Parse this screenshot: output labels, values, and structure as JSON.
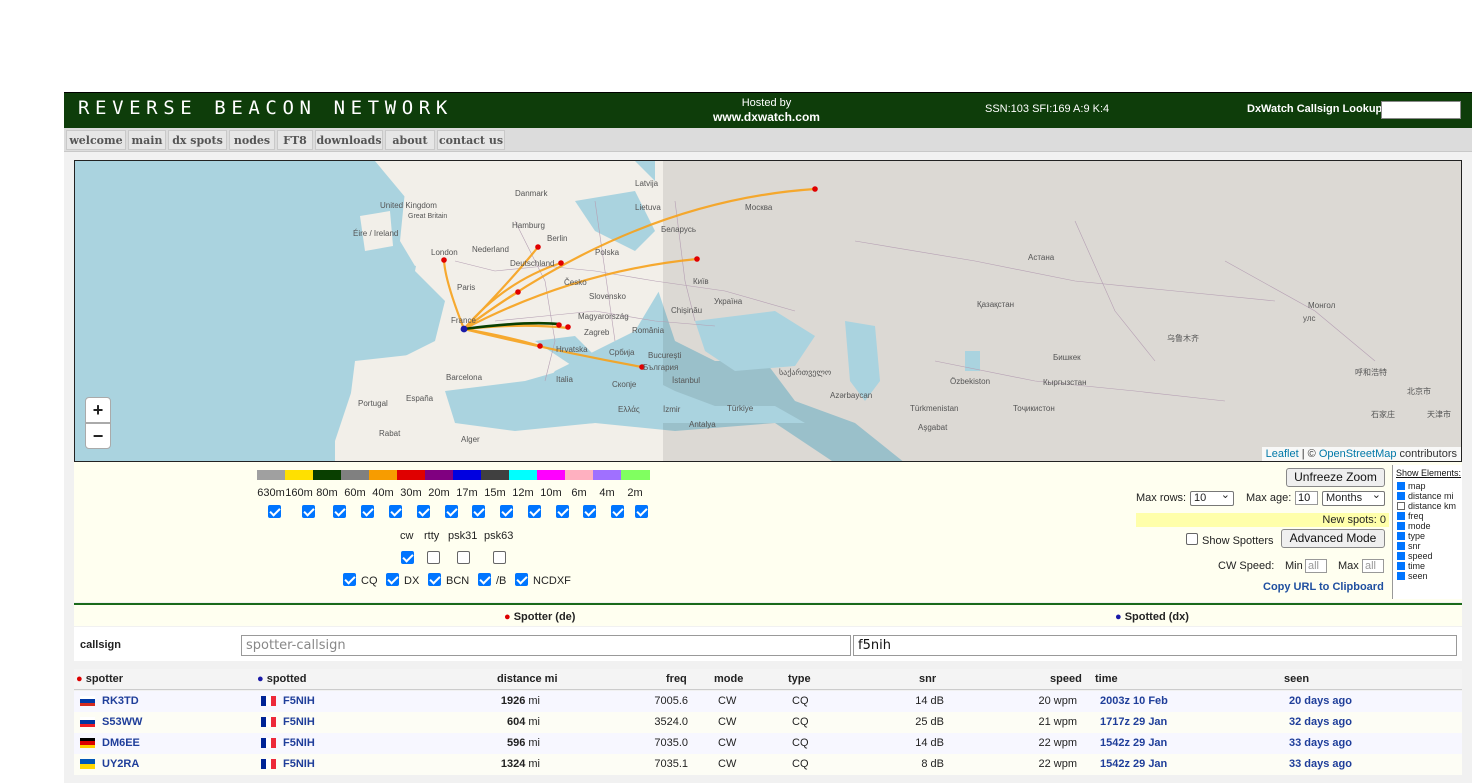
{
  "header": {
    "logo": "REVERSE BEACON NETWORK",
    "hosted_line1": "Hosted by",
    "hosted_line2": "www.dxwatch.com",
    "solar": "SSN:103 SFI:169 A:9 K:4",
    "lookup_label": "DxWatch Callsign Lookup:",
    "lookup_value": ""
  },
  "nav": {
    "tabs": [
      {
        "label": "welcome"
      },
      {
        "label": "main"
      },
      {
        "label": "dx spots"
      },
      {
        "label": "nodes"
      },
      {
        "label": "FT8"
      },
      {
        "label": "downloads"
      },
      {
        "label": "about"
      },
      {
        "label": "contact us"
      }
    ]
  },
  "map": {
    "zoom_in": "+",
    "zoom_out": "−",
    "attribution_leaflet": "Leaflet",
    "attribution_sep": " | © ",
    "attribution_osm": "OpenStreetMap",
    "attribution_tail": " contributors",
    "labels": [
      {
        "text": "Danmark"
      },
      {
        "text": "Latvija"
      },
      {
        "text": "Lietuva"
      },
      {
        "text": "Москва"
      },
      {
        "text": "United Kingdom"
      },
      {
        "text": "Great Britain"
      },
      {
        "text": "Éire / Ireland"
      },
      {
        "text": "Hamburg"
      },
      {
        "text": "Berlin"
      },
      {
        "text": "Nederland"
      },
      {
        "text": "London"
      },
      {
        "text": "Беларусь"
      },
      {
        "text": "Deutschland"
      },
      {
        "text": "Polska"
      },
      {
        "text": "Česko"
      },
      {
        "text": "Paris"
      },
      {
        "text": "Київ"
      },
      {
        "text": "Україна"
      },
      {
        "text": "Slovensko"
      },
      {
        "text": "France"
      },
      {
        "text": "Magyarország"
      },
      {
        "text": "Chișinău"
      },
      {
        "text": "Zagreb"
      },
      {
        "text": "România"
      },
      {
        "text": "Hrvatska"
      },
      {
        "text": "Србија"
      },
      {
        "text": "București"
      },
      {
        "text": "България"
      },
      {
        "text": "Barcelona"
      },
      {
        "text": "Italia"
      },
      {
        "text": "Скопје"
      },
      {
        "text": "İstanbul"
      },
      {
        "text": "España"
      },
      {
        "text": "Portugal"
      },
      {
        "text": "Ελλάς"
      },
      {
        "text": "İzmir"
      },
      {
        "text": "Türkiye"
      },
      {
        "text": "Antalya"
      },
      {
        "text": "Rabat"
      },
      {
        "text": "Alger"
      },
      {
        "text": "Астана"
      },
      {
        "text": "Қазақстан"
      },
      {
        "text": "Монгол"
      },
      {
        "text": "улс"
      },
      {
        "text": "乌鲁木齐"
      },
      {
        "text": "Бишкек"
      },
      {
        "text": "Özbekiston"
      },
      {
        "text": "Кыргызстан"
      },
      {
        "text": "Türkmenistan"
      },
      {
        "text": "Тоҷикистон"
      },
      {
        "text": "Aşgabat"
      },
      {
        "text": "საქართველო"
      },
      {
        "text": "Azərbaycan"
      },
      {
        "text": "呼和浩特"
      },
      {
        "text": "北京市"
      },
      {
        "text": "天津市"
      },
      {
        "text": "石家庄"
      }
    ]
  },
  "bands": [
    {
      "label": "630m",
      "color": "#a0a0a0",
      "checked": true
    },
    {
      "label": "160m",
      "color": "#ffe000",
      "checked": true
    },
    {
      "label": "80m",
      "color": "#093f00",
      "checked": true
    },
    {
      "label": "60m",
      "color": "#808080",
      "checked": true
    },
    {
      "label": "40m",
      "color": "#f79c00",
      "checked": true
    },
    {
      "label": "30m",
      "color": "#e00000",
      "checked": true
    },
    {
      "label": "20m",
      "color": "#800080",
      "checked": true
    },
    {
      "label": "17m",
      "color": "#0000e0",
      "checked": true
    },
    {
      "label": "15m",
      "color": "#404040",
      "checked": true
    },
    {
      "label": "12m",
      "color": "#00ffff",
      "checked": true
    },
    {
      "label": "10m",
      "color": "#ff00ff",
      "checked": true
    },
    {
      "label": "6m",
      "color": "#ffb0c0",
      "checked": true
    },
    {
      "label": "4m",
      "color": "#a070ff",
      "checked": true
    },
    {
      "label": "2m",
      "color": "#80ff60",
      "checked": true
    }
  ],
  "modes": [
    {
      "label": "cw",
      "checked": true
    },
    {
      "label": "rtty",
      "checked": false
    },
    {
      "label": "psk31",
      "checked": false
    },
    {
      "label": "psk63",
      "checked": false
    }
  ],
  "types": [
    {
      "label": "CQ",
      "checked": true
    },
    {
      "label": "DX",
      "checked": true
    },
    {
      "label": "BCN",
      "checked": true
    },
    {
      "label": "/B",
      "checked": true
    },
    {
      "label": "NCDXF",
      "checked": true
    }
  ],
  "right_controls": {
    "unfreeze": "Unfreeze Zoom",
    "max_rows_label": "Max rows:",
    "max_rows_value": "10",
    "max_age_label": "Max age:",
    "max_age_value": "10",
    "max_age_unit": "Months",
    "new_spots": "New spots: 0",
    "show_spotters": "Show Spotters",
    "show_spotters_checked": false,
    "advanced": "Advanced Mode",
    "cw_speed_label": "CW Speed:",
    "min_label": "Min",
    "max_label": "Max",
    "min_placeholder": "all",
    "max_placeholder": "all",
    "copy_url": "Copy URL to Clipboard"
  },
  "show_elements": {
    "title": "Show Elements:",
    "items": [
      {
        "label": "map",
        "checked": true
      },
      {
        "label": "distance mi",
        "checked": true
      },
      {
        "label": "distance km",
        "checked": false
      },
      {
        "label": "freq",
        "checked": true
      },
      {
        "label": "mode",
        "checked": true
      },
      {
        "label": "type",
        "checked": true
      },
      {
        "label": "snr",
        "checked": true
      },
      {
        "label": "speed",
        "checked": true
      },
      {
        "label": "time",
        "checked": true
      },
      {
        "label": "seen",
        "checked": true
      }
    ]
  },
  "filter": {
    "spotter_header": "Spotter (de)",
    "spotted_header": "Spotted (dx)",
    "callsign_label": "callsign",
    "spotter_placeholder": "spotter-callsign",
    "spotted_value": "f5nih"
  },
  "table": {
    "columns": {
      "spotter": "spotter",
      "spotted": "spotted",
      "distance": "distance mi",
      "freq": "freq",
      "mode": "mode",
      "type": "type",
      "snr": "snr",
      "speed": "speed",
      "time": "time",
      "seen": "seen"
    },
    "rows": [
      {
        "spotter": "RK3TD",
        "spotter_flag": "ru",
        "spotted": "F5NIH",
        "dist": "1926",
        "unit": "mi",
        "freq": "7005.6",
        "mode": "CW",
        "type": "CQ",
        "snr": "14 dB",
        "speed": "20 wpm",
        "time": "2003z 10 Feb",
        "seen": "20 days ago"
      },
      {
        "spotter": "S53WW",
        "spotter_flag": "si",
        "spotted": "F5NIH",
        "dist": "604",
        "unit": "mi",
        "freq": "3524.0",
        "mode": "CW",
        "type": "CQ",
        "snr": "25 dB",
        "speed": "21 wpm",
        "time": "1717z 29 Jan",
        "seen": "32 days ago"
      },
      {
        "spotter": "DM6EE",
        "spotter_flag": "de",
        "spotted": "F5NIH",
        "dist": "596",
        "unit": "mi",
        "freq": "7035.0",
        "mode": "CW",
        "type": "CQ",
        "snr": "14 dB",
        "speed": "22 wpm",
        "time": "1542z 29 Jan",
        "seen": "33 days ago"
      },
      {
        "spotter": "UY2RA",
        "spotter_flag": "ua",
        "spotted": "F5NIH",
        "dist": "1324",
        "unit": "mi",
        "freq": "7035.1",
        "mode": "CW",
        "type": "CQ",
        "snr": "8 dB",
        "speed": "22 wpm",
        "time": "1542z 29 Jan",
        "seen": "33 days ago"
      }
    ]
  }
}
